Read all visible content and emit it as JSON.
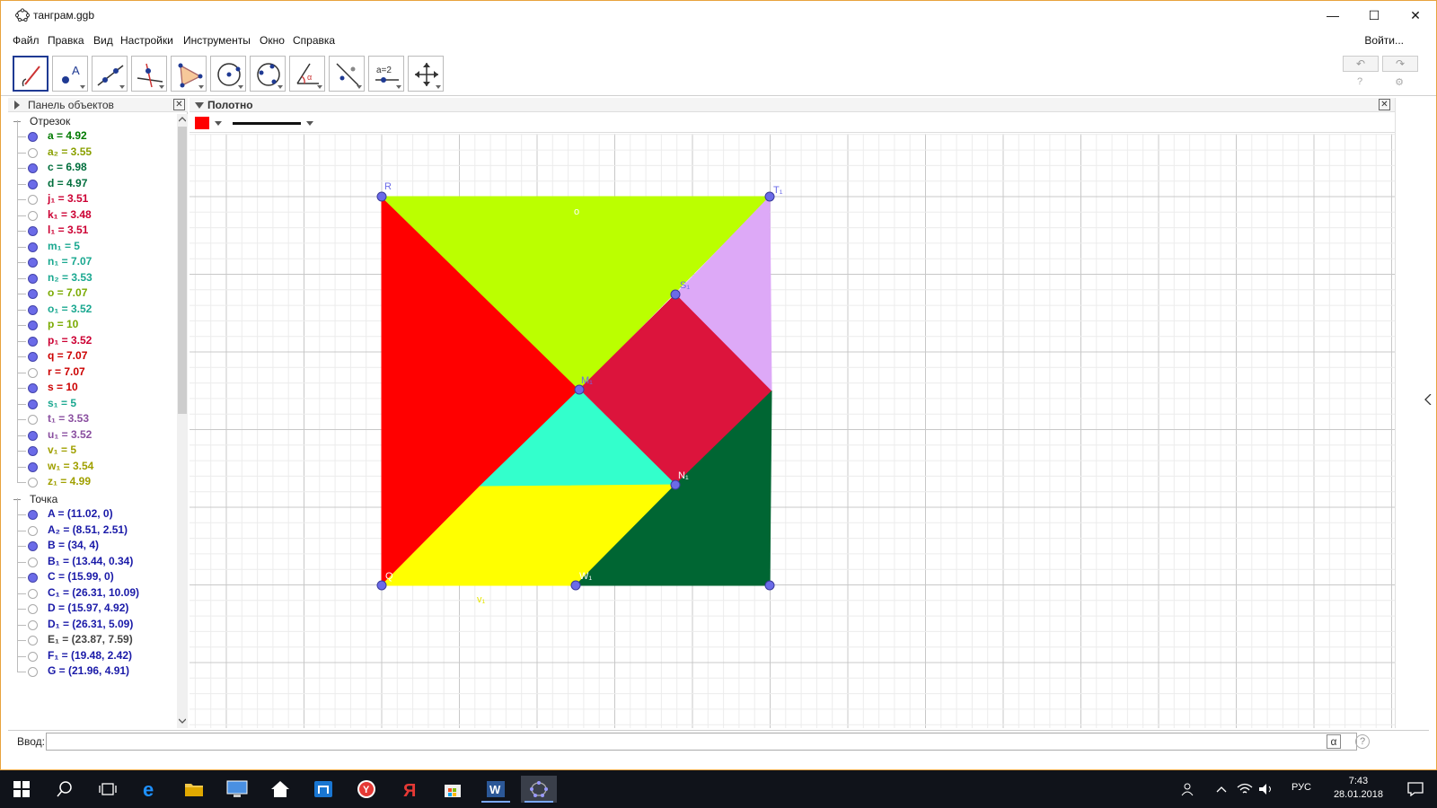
{
  "window": {
    "title": "танграм.ggb",
    "controls": {
      "minimize": "—",
      "maximize": "☐",
      "close": "✕"
    }
  },
  "menu": {
    "items": [
      "Файл",
      "Правка",
      "Вид",
      "Настройки",
      "Инструменты",
      "Окно",
      "Справка"
    ],
    "login": "Войти..."
  },
  "toolbar": {
    "tools": [
      "move-tool",
      "point-tool",
      "line-tool",
      "perpendicular-line-tool",
      "polygon-tool",
      "circle-tool",
      "conic-tool",
      "angle-tool",
      "reflect-tool",
      "slider-tool",
      "move-graphics-view-tool"
    ],
    "slider_label": "a=2",
    "undo": "↶",
    "redo": "↷",
    "help": "?",
    "settings": "⚙"
  },
  "algebra": {
    "title": "Панель объектов",
    "groups": [
      {
        "name": "Отрезок",
        "items": [
          {
            "label": "a = 4.92",
            "color": "#007a00",
            "visible": true
          },
          {
            "label": "a₂ = 3.55",
            "color": "#8aa000",
            "visible": false
          },
          {
            "label": "c = 6.98",
            "color": "#006e3c",
            "visible": true
          },
          {
            "label": "d = 4.97",
            "color": "#006e3c",
            "visible": true
          },
          {
            "label": "j₁ = 3.51",
            "color": "#cc0033",
            "visible": false
          },
          {
            "label": "k₁ = 3.48",
            "color": "#cc0033",
            "visible": false
          },
          {
            "label": "l₁ = 3.51",
            "color": "#cc0033",
            "visible": true
          },
          {
            "label": "m₁ = 5",
            "color": "#1aa890",
            "visible": true
          },
          {
            "label": "n₁ = 7.07",
            "color": "#1aa890",
            "visible": true
          },
          {
            "label": "n₂ = 3.53",
            "color": "#1aa890",
            "visible": true
          },
          {
            "label": "o = 7.07",
            "color": "#7aaa00",
            "visible": true
          },
          {
            "label": "o₁ = 3.52",
            "color": "#1aa890",
            "visible": true
          },
          {
            "label": "p = 10",
            "color": "#7aaa00",
            "visible": true
          },
          {
            "label": "p₁ = 3.52",
            "color": "#cc0033",
            "visible": true
          },
          {
            "label": "q = 7.07",
            "color": "#cc0000",
            "visible": true
          },
          {
            "label": "r = 7.07",
            "color": "#cc0000",
            "visible": false
          },
          {
            "label": "s = 10",
            "color": "#cc0000",
            "visible": true
          },
          {
            "label": "s₁ = 5",
            "color": "#1aa890",
            "visible": true
          },
          {
            "label": "t₁ = 3.53",
            "color": "#8a4fa0",
            "visible": false
          },
          {
            "label": "u₁ = 3.52",
            "color": "#8a4fa0",
            "visible": true
          },
          {
            "label": "v₁ = 5",
            "color": "#a0a000",
            "visible": true
          },
          {
            "label": "w₁ = 3.54",
            "color": "#a0a000",
            "visible": true
          },
          {
            "label": "z₁ = 4.99",
            "color": "#a0a000",
            "visible": false
          }
        ]
      },
      {
        "name": "Точка",
        "items": [
          {
            "label": "A = (11.02, 0)",
            "color": "#1a1aa8",
            "visible": true
          },
          {
            "label": "A₂ = (8.51, 2.51)",
            "color": "#1a1aa8",
            "visible": false
          },
          {
            "label": "B = (34, 4)",
            "color": "#1a1aa8",
            "visible": true
          },
          {
            "label": "B₁ = (13.44, 0.34)",
            "color": "#1a1aa8",
            "visible": false
          },
          {
            "label": "C = (15.99, 0)",
            "color": "#1a1aa8",
            "visible": true
          },
          {
            "label": "C₁ = (26.31, 10.09)",
            "color": "#1a1aa8",
            "visible": false
          },
          {
            "label": "D = (15.97, 4.92)",
            "color": "#1a1aa8",
            "visible": false
          },
          {
            "label": "D₁ = (26.31, 5.09)",
            "color": "#1a1aa8",
            "visible": false
          },
          {
            "label": "E₁ = (23.87, 7.59)",
            "color": "#444444",
            "visible": false
          },
          {
            "label": "F₁ = (19.48, 2.42)",
            "color": "#1a1aa8",
            "visible": false
          },
          {
            "label": "G = (21.96, 4.91)",
            "color": "#1a1aa8",
            "visible": false
          }
        ]
      }
    ]
  },
  "graphics": {
    "title": "Полотно",
    "style_color": "#ff0000",
    "pieces": {
      "red": "#ff0000",
      "lime": "#bbff00",
      "lavender": "#dda9f7",
      "crimson": "#dc143c",
      "aqua": "#33ffcc",
      "yellow": "#ffff00",
      "green": "#006633"
    },
    "labels": {
      "R": "R",
      "T1": "T₁",
      "S1": "S₁",
      "M1": "M₁",
      "N1": "N₁",
      "Q": "Q",
      "W1": "W₁",
      "V1": "v₁",
      "O": "o"
    }
  },
  "input": {
    "label": "Ввод:",
    "alpha": "α",
    "help": "?"
  },
  "taskbar": {
    "lang": "РУС",
    "time": "7:43",
    "date": "28.01.2018"
  }
}
